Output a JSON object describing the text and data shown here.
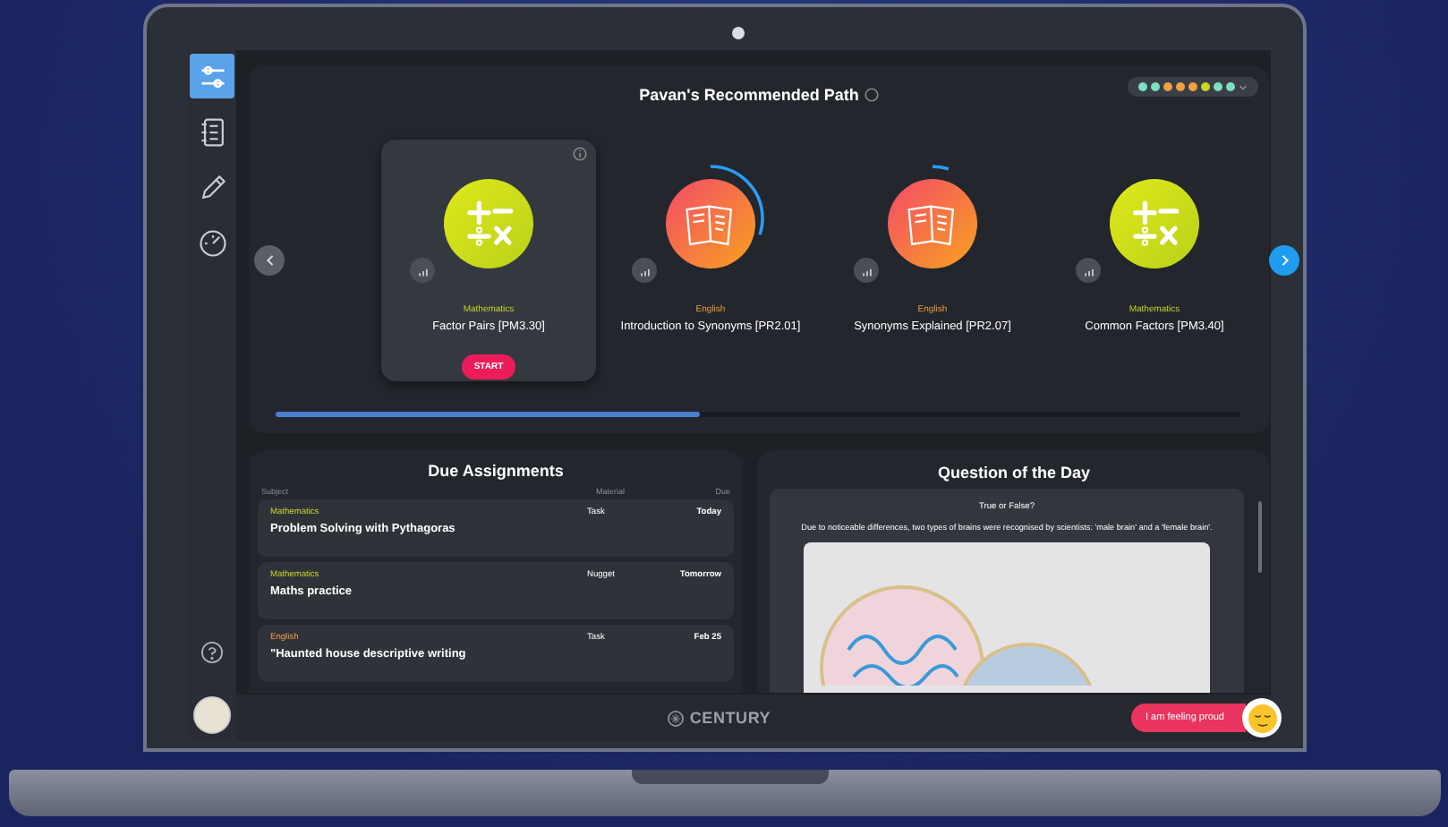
{
  "sidebar": {
    "items": [
      {
        "selected": true
      },
      {
        "selected": false
      },
      {
        "selected": false
      },
      {
        "selected": false
      }
    ]
  },
  "path": {
    "title": "Pavan's Recommended Path",
    "level": 0.44,
    "dots": [
      {
        "color": "#7de0c0"
      },
      {
        "color": "#7de0c0"
      },
      {
        "color": "#f0a040"
      },
      {
        "color": "#f0a040"
      },
      {
        "color": "#f0a040"
      },
      {
        "color": "#c8d62a"
      },
      {
        "color": "#7de0c0"
      },
      {
        "color": "#7de0c0"
      }
    ],
    "cards": [
      {
        "kind": "maths",
        "subject": "Mathematics",
        "title": "Factor Pairs [PM3.30]",
        "selected": true,
        "action": "START"
      },
      {
        "kind": "english",
        "subject": "English",
        "title": "Introduction to Synonyms [PR2.01]",
        "selected": false,
        "level": 0.3
      },
      {
        "kind": "english",
        "subject": "English",
        "title": "Synonyms Explained [PR2.07]",
        "selected": false,
        "level": 0.05
      },
      {
        "kind": "maths",
        "subject": "Mathematics",
        "title": "Common Factors [PM3.40]",
        "selected": false
      }
    ]
  },
  "assignments": {
    "title": "Due Assignments",
    "columns": [
      "Subject",
      "Material",
      "Due"
    ],
    "rows": [
      {
        "kind": "maths",
        "subject": "Mathematics",
        "title": "Problem Solving with Pythagoras",
        "material": "Task",
        "due": "Today"
      },
      {
        "kind": "maths",
        "subject": "Mathematics",
        "title": "Maths practice",
        "material": "Nugget",
        "due": "Tomorrow"
      },
      {
        "kind": "english",
        "subject": "English",
        "title": "\"Haunted house descriptive writing",
        "material": "Task",
        "due": "Feb 25"
      }
    ]
  },
  "question": {
    "title": "Question of the Day",
    "kicker": "True or False?",
    "text": "Due to noticeable differences, two types of brains were recognised by scientists: 'male brain' and a 'female brain'."
  },
  "footer": {
    "brand": "CENTURY",
    "mood": "I am feeling proud"
  }
}
